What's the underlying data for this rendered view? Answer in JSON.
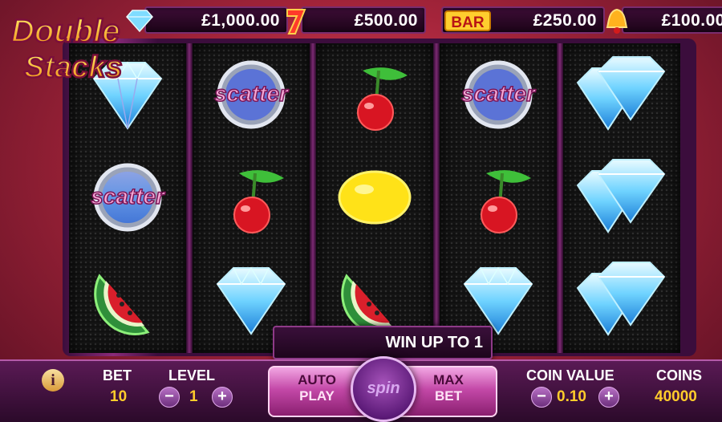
{
  "logo": {
    "line1": "Double",
    "line2": "Stacks"
  },
  "jackpots": [
    {
      "icon": "diamond-icon",
      "value": "£1,000.00"
    },
    {
      "icon": "seven-icon",
      "value": "£500.00"
    },
    {
      "icon": "bar-icon",
      "label": "BAR",
      "value": "£250.00"
    },
    {
      "icon": "bell-icon",
      "value": "£100.00"
    }
  ],
  "reels": [
    [
      "diamond",
      "scatter",
      "watermelon"
    ],
    [
      "scatter",
      "cherry",
      "diamond"
    ],
    [
      "cherry",
      "lemon",
      "watermelon"
    ],
    [
      "scatter",
      "cherry",
      "diamond"
    ],
    [
      "diamond",
      "diamond",
      "diamond"
    ]
  ],
  "scatter_text": "scatter",
  "win_banner": "WIN UP TO 1",
  "panel": {
    "info": "i",
    "bet_label": "BET",
    "bet_value": "10",
    "level_label": "LEVEL",
    "level_value": "1",
    "auto_line1": "AUTO",
    "auto_line2": "PLAY",
    "spin_label": "spin",
    "max_line1": "MAX",
    "max_line2": "BET",
    "coin_value_label": "COIN VALUE",
    "coin_value": "0.10",
    "coins_label": "COINS",
    "coins_value": "40000",
    "minus": "−",
    "plus": "+"
  },
  "colors": {
    "accent": "#ffcc2b",
    "frame": "#8a2a7a",
    "background": "#a4243a"
  }
}
